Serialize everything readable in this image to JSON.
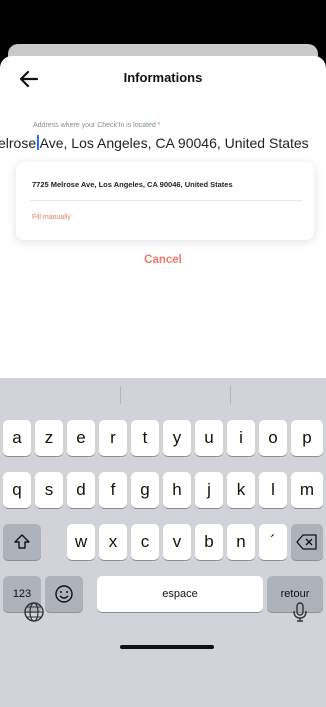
{
  "header": {
    "title": "Informations",
    "back_icon": "arrow-left-icon"
  },
  "address_field": {
    "label": "Address where your Check'In is located",
    "required_marker": "*",
    "value_before_cursor": "elrose",
    "value_after_cursor": "Ave, Los Angeles, CA 90046, United States"
  },
  "suggestions": {
    "items": [
      "7725 Melrose Ave, Los Angeles, CA 90046, United States"
    ],
    "fill_manually": "Fill manually"
  },
  "cancel_label": "Cancel",
  "keyboard": {
    "row1": [
      "a",
      "z",
      "e",
      "r",
      "t",
      "y",
      "u",
      "i",
      "o",
      "p"
    ],
    "row2": [
      "q",
      "s",
      "d",
      "f",
      "g",
      "h",
      "j",
      "k",
      "l",
      "m"
    ],
    "row3": [
      "w",
      "x",
      "c",
      "v",
      "b",
      "n",
      "´"
    ],
    "numbers_key": "123",
    "space_key": "espace",
    "return_key": "retour"
  },
  "colors": {
    "accent": "#f07a6a",
    "caret": "#2f6fea",
    "keyboard_bg": "#d1d3d9"
  }
}
